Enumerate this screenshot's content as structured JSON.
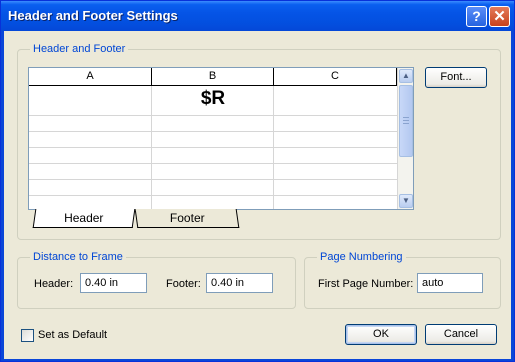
{
  "window": {
    "title": "Header and Footer Settings",
    "help_glyph": "?",
    "close_glyph": "✕"
  },
  "header_footer_group": {
    "label": "Header and Footer",
    "columns": [
      "A",
      "B",
      "C"
    ],
    "cell_value": "$R",
    "tabs": [
      {
        "label": "Header",
        "active": true
      },
      {
        "label": "Footer",
        "active": false
      }
    ],
    "font_button": "Font..."
  },
  "distance_group": {
    "label": "Distance to Frame",
    "header_label": "Header:",
    "header_value": "0.40 in",
    "footer_label": "Footer:",
    "footer_value": "0.40 in"
  },
  "page_numbering_group": {
    "label": "Page Numbering",
    "first_page_label": "First Page Number:",
    "first_page_value": "auto"
  },
  "footer": {
    "default_checkbox_label": "Set as Default",
    "default_checked": false,
    "ok_label": "OK",
    "cancel_label": "Cancel"
  },
  "icons": {
    "scroll_up": "▲",
    "scroll_down": "▼"
  },
  "colors": {
    "titlebar": "#0554e6",
    "group_label": "#0046d5",
    "dialog_bg": "#ece9d8"
  }
}
